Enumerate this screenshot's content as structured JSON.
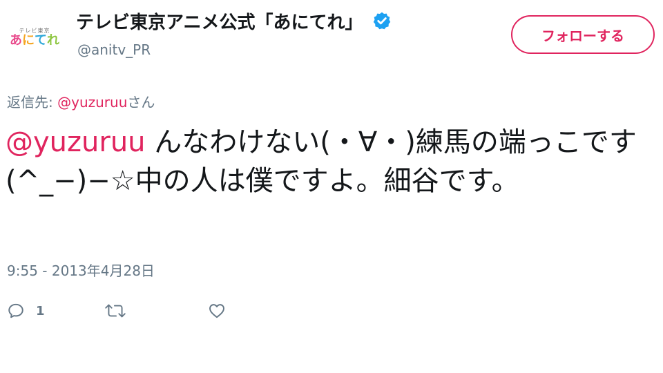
{
  "account": {
    "display_name": "テレビ東京アニメ公式「あにてれ」",
    "handle": "@anitv_PR",
    "avatar_logo": {
      "top_text": "テレビ東京",
      "chars": [
        "あ",
        "に",
        "て",
        "れ"
      ]
    },
    "verified_icon": "verified-badge-icon"
  },
  "follow_button": {
    "label": "フォローする"
  },
  "reply_to": {
    "prefix": "返信先: ",
    "mention": "@yuzuruu",
    "suffix": "さん"
  },
  "tweet": {
    "mention": "@yuzuruu",
    "text": " んなわけない(・∀・)練馬の端っこです(^_−)−☆中の人は僕ですよ。細谷です。",
    "timestamp": "9:55 - 2013年4月28日"
  },
  "actions": {
    "reply_count": "1",
    "icons": [
      "reply-icon",
      "retweet-icon",
      "like-icon"
    ]
  },
  "colors": {
    "accent": "#e0245e",
    "muted": "#657786",
    "text": "#14171a",
    "verified": "#1da1f2"
  }
}
